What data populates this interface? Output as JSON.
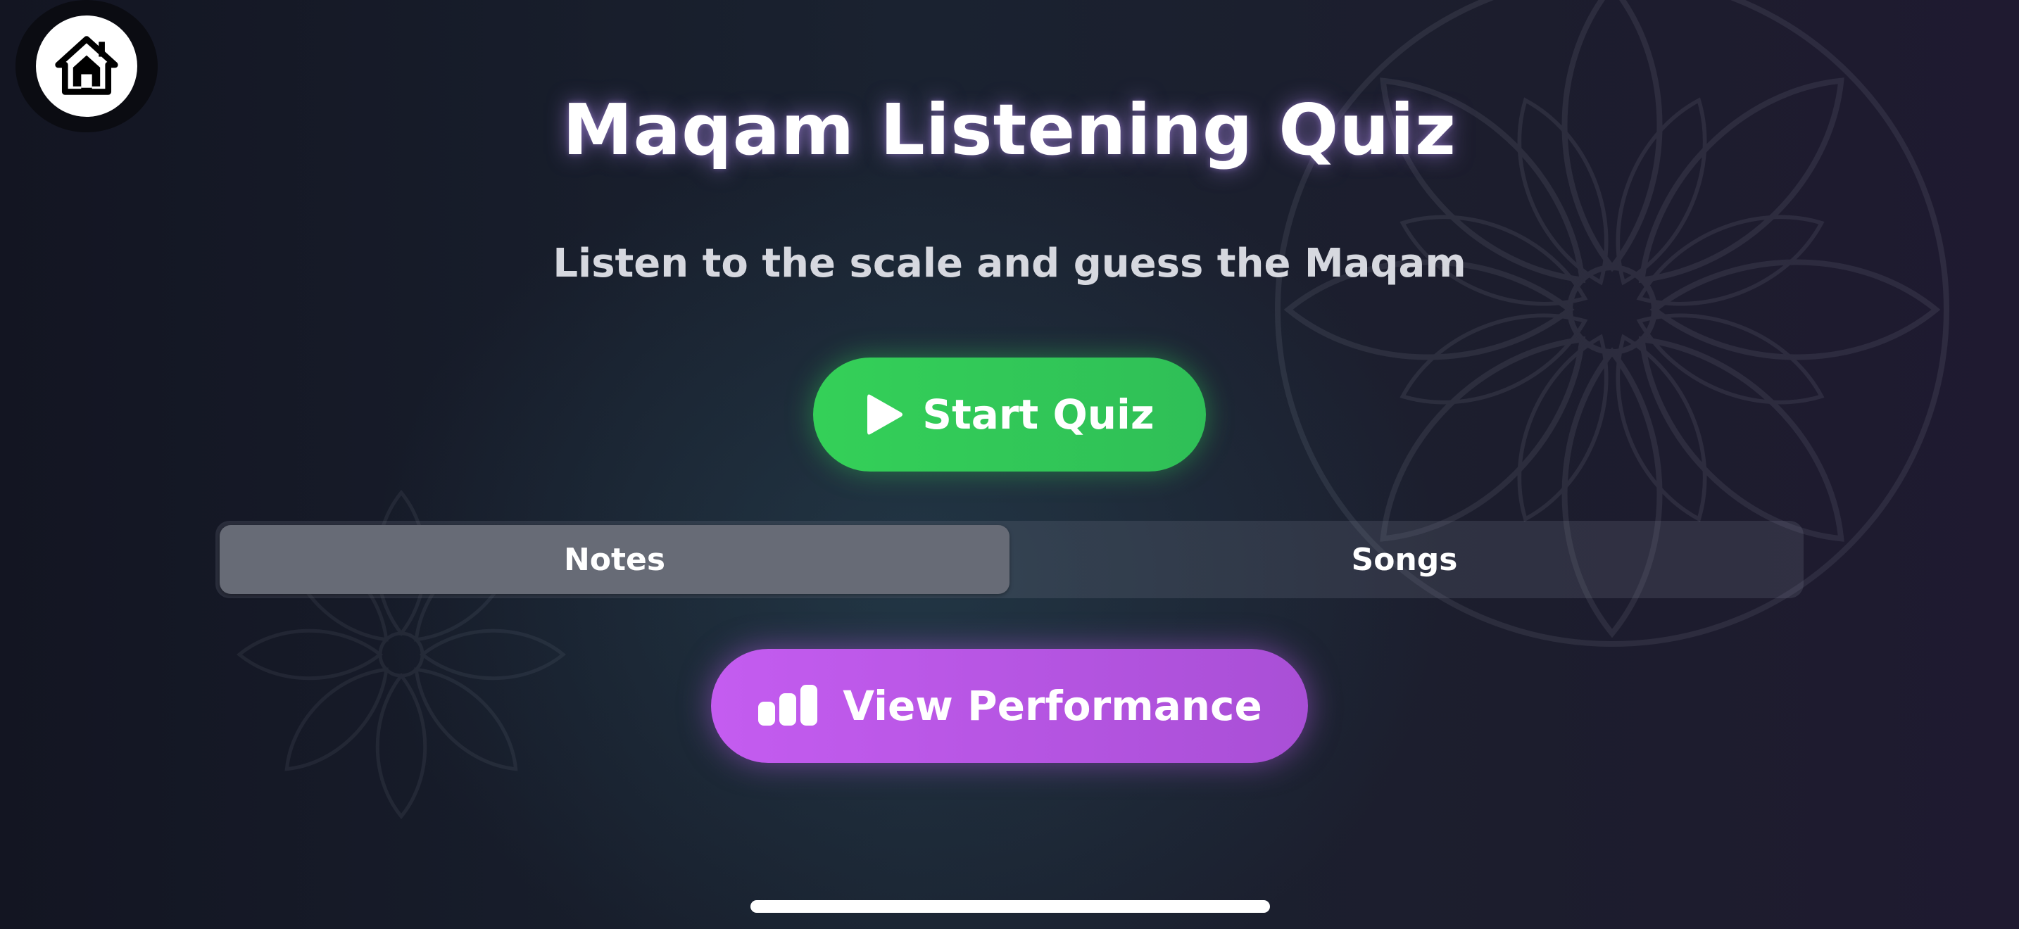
{
  "header": {
    "home_icon": "house-icon",
    "title": "Maqam Listening Quiz",
    "subtitle": "Listen to the scale and guess the Maqam"
  },
  "actions": {
    "start": {
      "label": "Start Quiz",
      "icon": "play-icon",
      "color": "#34d058"
    },
    "performance": {
      "label": "View Performance",
      "icon": "bar-chart-icon",
      "color": "#c45cf0"
    }
  },
  "mode_selector": {
    "options": [
      {
        "label": "Notes",
        "selected": true
      },
      {
        "label": "Songs",
        "selected": false
      }
    ]
  },
  "colors": {
    "background": "#1a2230",
    "title_glow": "#be96ff",
    "segment_selected": "#676b76"
  }
}
